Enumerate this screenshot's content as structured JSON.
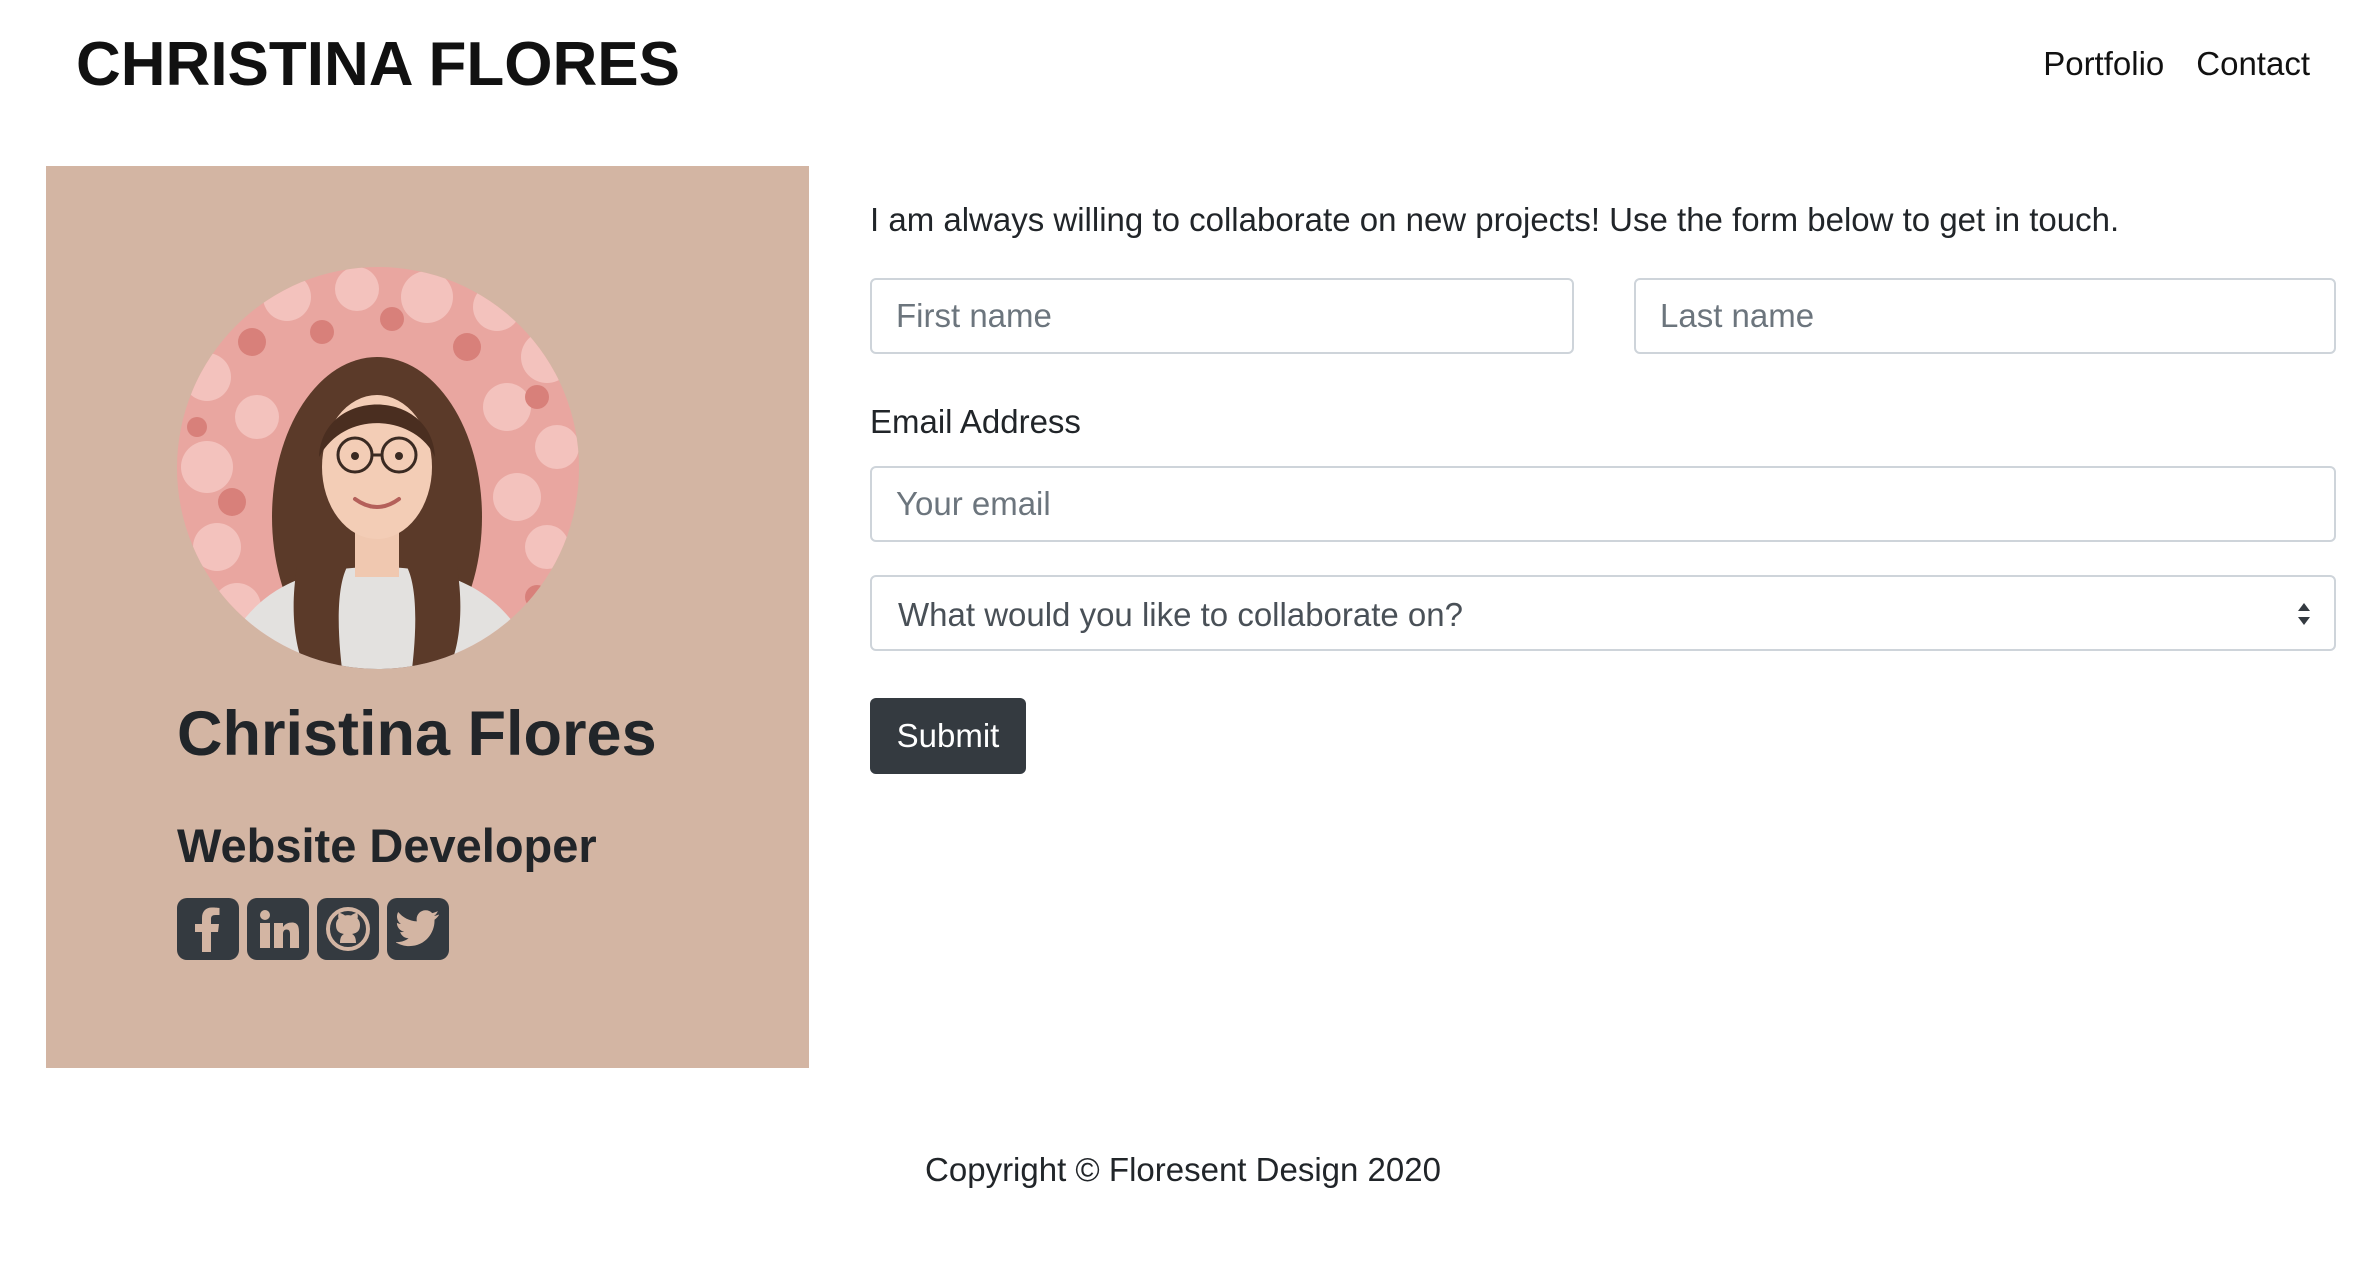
{
  "header": {
    "brand": "CHRISTINA FLORES",
    "nav": [
      "Portfolio",
      "Contact"
    ]
  },
  "profile": {
    "photo_alt": "Portrait of Christina Flores in front of a wall of pink roses",
    "name": "Christina Flores",
    "role": "Website Developer",
    "panel_color": "#d3b5a3",
    "social_icons": [
      "facebook-icon",
      "linkedin-icon",
      "github-icon",
      "twitter-icon"
    ]
  },
  "contact_form": {
    "intro": "I am always willing to collaborate on new projects! Use the form below to get in touch.",
    "first_name_placeholder": "First name",
    "last_name_placeholder": "Last name",
    "email_label": "Email Address",
    "email_placeholder": "Your email",
    "topic_selected": "What would you like to collaborate on?",
    "submit_label": "Submit",
    "button_color": "#343a40"
  },
  "footer": {
    "copyright": "Copyright © Floresent Design 2020"
  }
}
